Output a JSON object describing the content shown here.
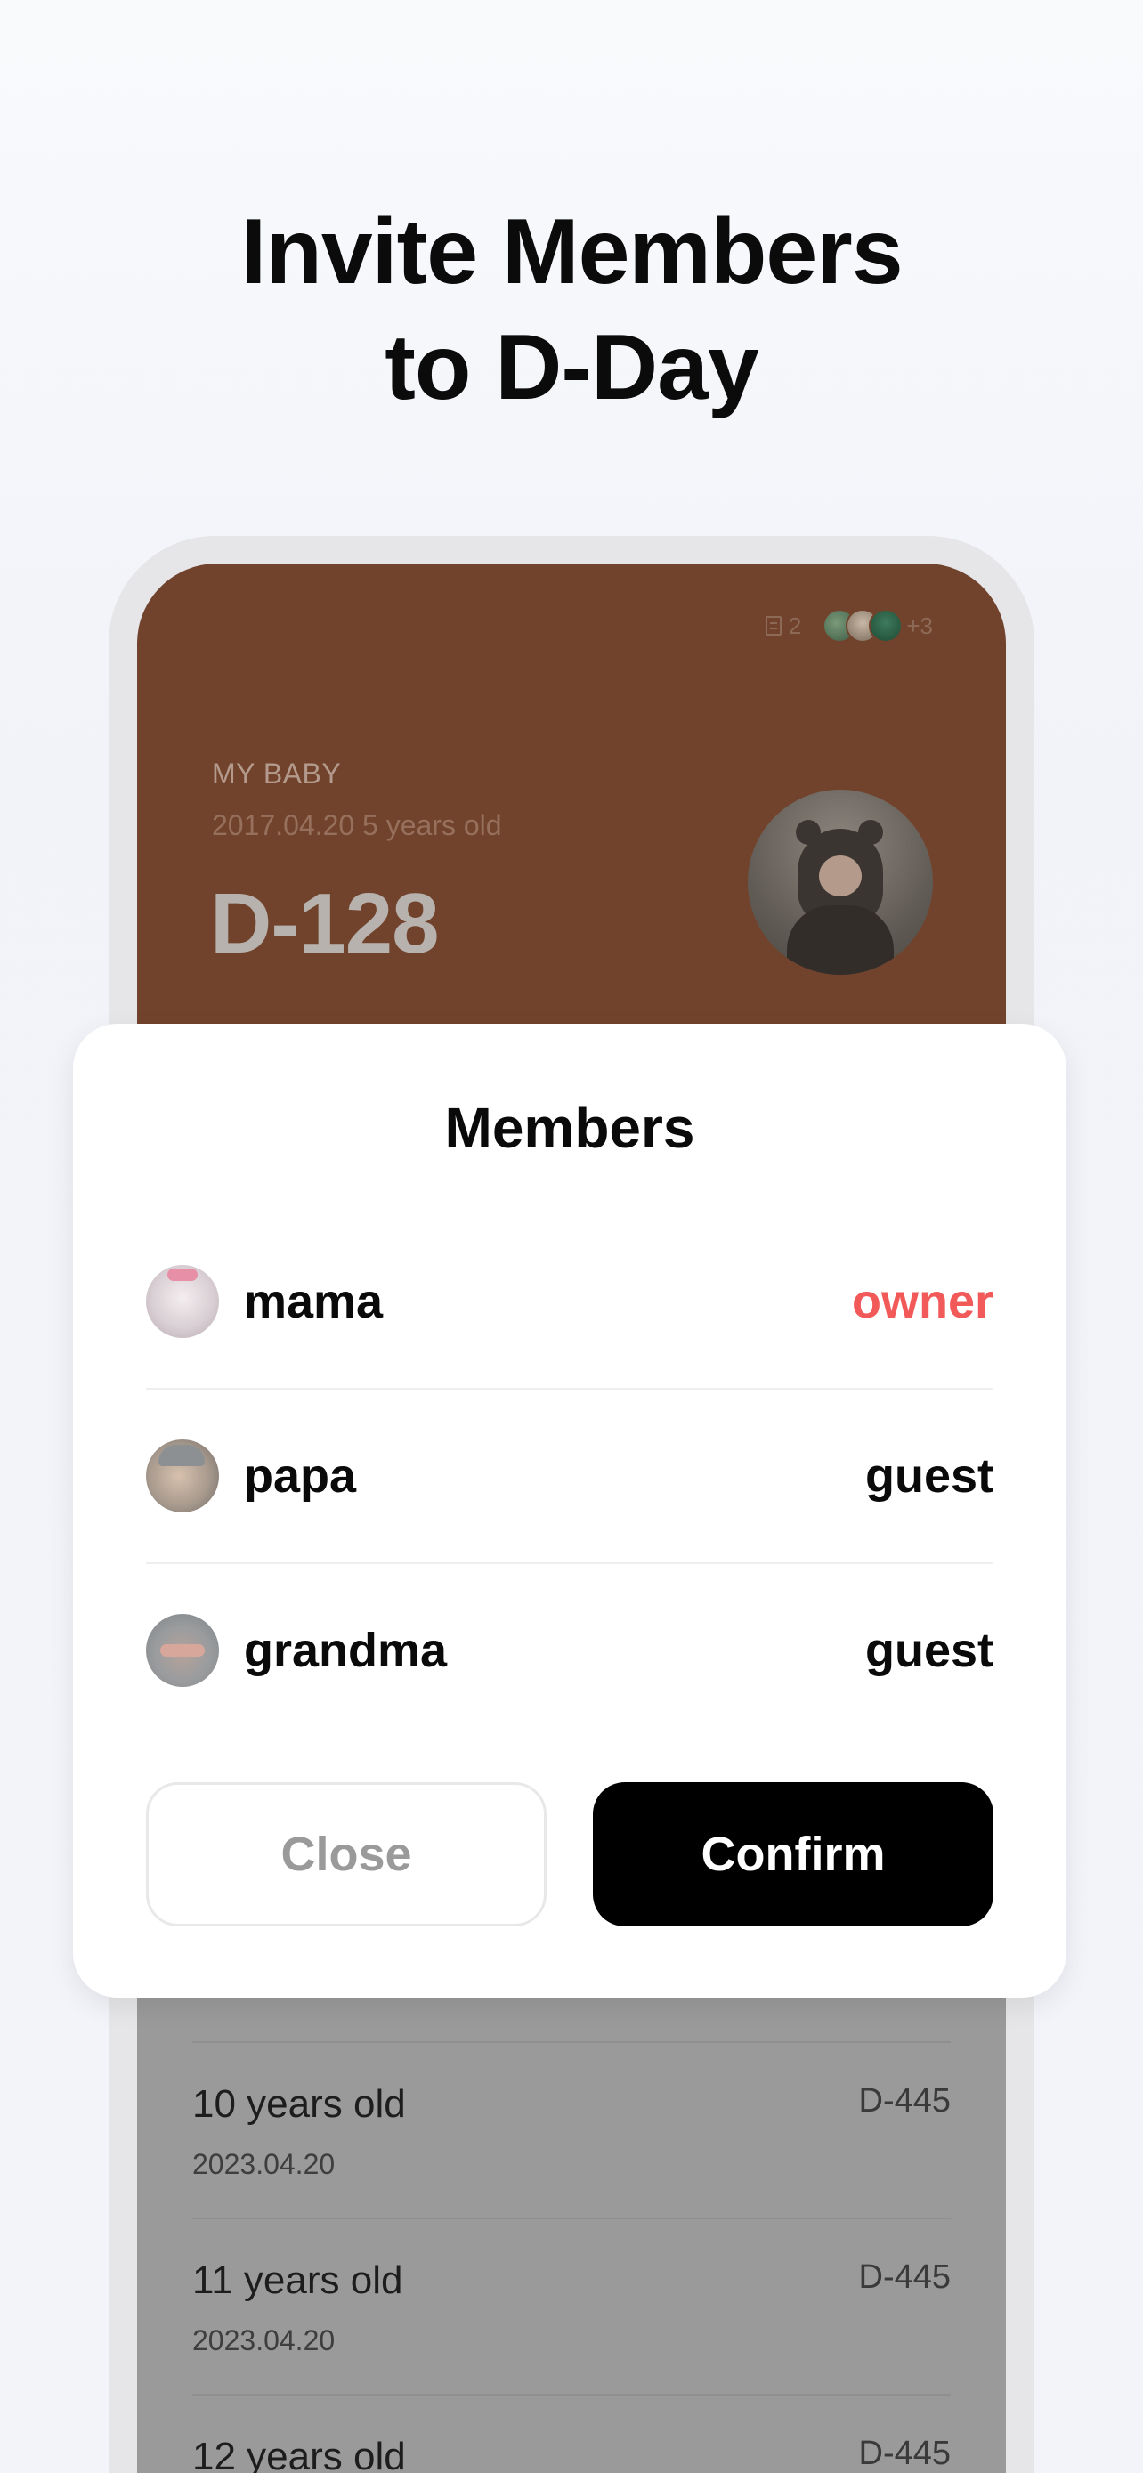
{
  "headline": {
    "line1": "Invite Members",
    "line2": "to D-Day"
  },
  "card": {
    "doc_count": "2",
    "more_members": "+3",
    "label": "MY BABY",
    "subtitle": "2017.04.20 5 years old",
    "dday": "D-128",
    "background_color": "#71432c"
  },
  "list": {
    "rows": [
      {
        "title": "10 years old",
        "date": "2023.04.20",
        "dday": "D-445"
      },
      {
        "title": "11 years old",
        "date": "2023.04.20",
        "dday": "D-445"
      },
      {
        "title": "12 years old",
        "date": "",
        "dday": "D-445"
      }
    ]
  },
  "modal": {
    "title": "Members",
    "members": [
      {
        "name": "mama",
        "role": "owner",
        "avatar": "baby-photo"
      },
      {
        "name": "papa",
        "role": "guest",
        "avatar": "baby-photo"
      },
      {
        "name": "grandma",
        "role": "guest",
        "avatar": "baby-photo"
      }
    ],
    "close_label": "Close",
    "confirm_label": "Confirm",
    "owner_color": "#f25a5a"
  }
}
